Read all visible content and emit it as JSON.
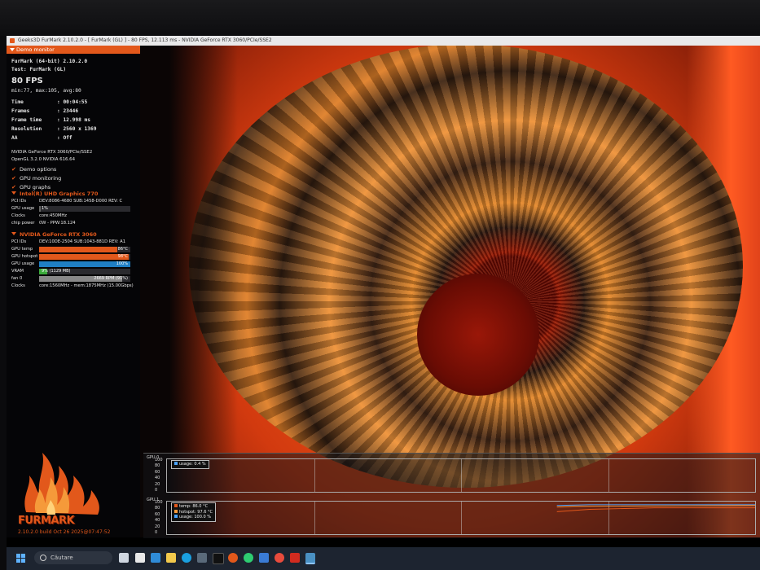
{
  "window": {
    "title": "Geeks3D FurMark 2.10.2.0 - [ FurMark (GL) ] - 80 FPS, 12.113 ms - NVIDIA GeForce RTX 3060/PCIe/SSE2"
  },
  "panel": {
    "header": "Demo monitor",
    "app_line": "FurMark (64-bit) 2.10.2.0",
    "test_line": "Test: FurMark (GL)",
    "fps": "80 FPS",
    "fps_stats": "min:77, max:105, avg:80",
    "stats": [
      {
        "label": "Time",
        "value": ": 00:04:55"
      },
      {
        "label": "Frames",
        "value": ": 23446"
      },
      {
        "label": "Frame time",
        "value": ": 12.998 ms"
      },
      {
        "label": "Resolution",
        "value": ": 2560 x 1369"
      },
      {
        "label": "AA",
        "value": ": Off"
      }
    ],
    "renderer": "NVIDIA GeForce RTX 3060/PCIe/SSE2",
    "opengl": "OpenGL 3.2.0 NVIDIA 616.64",
    "options": [
      {
        "label": "Demo options",
        "checked": true
      },
      {
        "label": "GPU monitoring",
        "checked": true
      },
      {
        "label": "GPU graphs",
        "checked": true
      }
    ],
    "check_mark": "✔",
    "gpu0": {
      "name": "Intel(R) UHD Graphics 770",
      "rows": [
        {
          "label": "PCI IDs",
          "value": "DEV:8086-4680 SUB:1458-D000 REV: C"
        },
        {
          "label": "GPU usage",
          "value": "1%",
          "fill": 0.01
        },
        {
          "label": "Clocks",
          "value": "core:450MHz"
        },
        {
          "label": "chip power",
          "value": "0W - PPW:18.124"
        }
      ]
    },
    "gpu1": {
      "name": "NVIDIA GeForce RTX 3060",
      "rows": [
        {
          "label": "PCI IDs",
          "value": "DEV:10DE-2504 SUB:1043-881D REV: A1"
        },
        {
          "label": "GPU temp",
          "value": "86°C",
          "fill": 0.86,
          "color": "#e2581b"
        },
        {
          "label": "GPU hotspot",
          "value": "98°C",
          "fill": 0.98,
          "color": "#e2581b"
        },
        {
          "label": "GPU usage",
          "value": "100%",
          "fill": 1.0,
          "color": "#1f7fc4"
        },
        {
          "label": "VRAM",
          "value": "9% (1129 MB)",
          "fill": 0.09,
          "color": "#3aaa3a"
        },
        {
          "label": "fan 0",
          "value": "2669 RPM (91%)",
          "fill": 0.91,
          "color": "#888888"
        },
        {
          "label": "Clocks",
          "value": "core:1560MHz - mem:1875MHz (15.00Gbps)"
        }
      ]
    },
    "logo_text": "FURMARK",
    "build": "2.10.2.0 build Oct 26 2025@07:47:52"
  },
  "graphs": {
    "yticks": [
      "100",
      "80",
      "60",
      "40",
      "20",
      "0"
    ],
    "gpu0": {
      "title": "GPU 0",
      "legend": [
        {
          "label": "usage: 0.4 %",
          "color": "#4aa3ff"
        }
      ]
    },
    "gpu1": {
      "title": "GPU 1",
      "legend": [
        {
          "label": "temp: 86.0 °C",
          "color": "#e2581b"
        },
        {
          "label": "hotspot: 97.6 °C",
          "color": "#ff9a3a"
        },
        {
          "label": "usage: 100.0 %",
          "color": "#4aa3ff"
        }
      ]
    }
  },
  "taskbar": {
    "search_placeholder": "Căutare"
  },
  "colors": {
    "accent": "#e2581b",
    "usage_blue": "#1f7fc4"
  }
}
